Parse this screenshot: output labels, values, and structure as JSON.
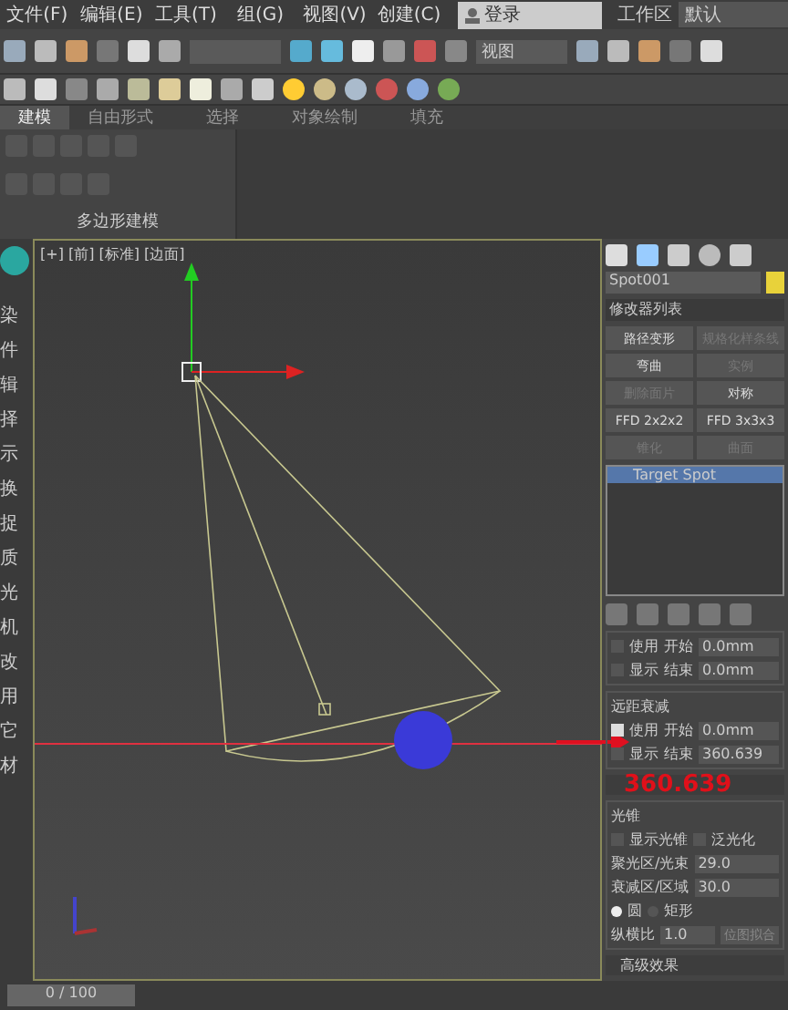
{
  "menu": [
    {
      "label": "文件(F)"
    },
    {
      "label": "编辑(E)"
    },
    {
      "label": "工具(T)"
    },
    {
      "label": "组(G)"
    },
    {
      "label": "视图(V)"
    },
    {
      "label": "创建(C)"
    }
  ],
  "login": {
    "label": "登录"
  },
  "workspace": {
    "label": "工作区",
    "value": "默认"
  },
  "toolbar": {
    "view_dropdown": "视图"
  },
  "ribbon_tabs": [
    {
      "label": "建模",
      "selected": true
    },
    {
      "label": "自由形式",
      "selected": false
    },
    {
      "label": "选择",
      "selected": false
    },
    {
      "label": "对象绘制",
      "selected": false
    },
    {
      "label": "填充",
      "selected": false
    }
  ],
  "ribbon_panel": {
    "title": "多边形建模"
  },
  "sidebar": [
    {
      "label": "染"
    },
    {
      "label": "件"
    },
    {
      "label": "辑"
    },
    {
      "label": "择"
    },
    {
      "label": "示"
    },
    {
      "label": "换"
    },
    {
      "label": "捉"
    },
    {
      "label": "质"
    },
    {
      "label": "光"
    },
    {
      "label": "机"
    },
    {
      "label": "改"
    },
    {
      "label": "用"
    },
    {
      "label": "它"
    },
    {
      "label": "材"
    }
  ],
  "viewport": {
    "label": "[+] [前] [标准] [边面]"
  },
  "timeline": {
    "text": "0 / 100"
  },
  "panel": {
    "object_name": "Spot001",
    "modifier_list": "修改器列表",
    "modifiers": [
      {
        "label": "路径变形",
        "disabled": false
      },
      {
        "label": "规格化样条线",
        "disabled": true
      },
      {
        "label": "弯曲",
        "disabled": false
      },
      {
        "label": "实例",
        "disabled": true
      },
      {
        "label": "删除面片",
        "disabled": true
      },
      {
        "label": "对称",
        "disabled": false
      },
      {
        "label": "FFD 2x2x2",
        "disabled": false
      },
      {
        "label": "FFD 3x3x3",
        "disabled": false
      },
      {
        "label": "锥化",
        "disabled": true
      },
      {
        "label": "曲面",
        "disabled": true
      }
    ],
    "stack": [
      {
        "label": "Target Spot",
        "selected": true
      }
    ]
  },
  "near_atten": {
    "rows": [
      {
        "check": "使用",
        "checked": false,
        "label": "开始",
        "value": "0.0mm"
      },
      {
        "check": "显示",
        "checked": false,
        "label": "结束",
        "value": "0.0mm"
      }
    ]
  },
  "far_atten": {
    "title": "远距衰减",
    "rows": [
      {
        "check": "使用",
        "checked": true,
        "label": "开始",
        "value": "0.0mm"
      },
      {
        "check": "显示",
        "checked": false,
        "label": "结束",
        "value": "360.639"
      }
    ]
  },
  "annotation": "360.639",
  "spot_params": {
    "group": "光锥",
    "show_cone": {
      "label": "显示光锥",
      "checked": false
    },
    "overshoot": {
      "label": "泛光化",
      "checked": false
    },
    "fields": [
      {
        "label": "聚光区/光束",
        "value": "29.0"
      },
      {
        "label": "衰减区/区域",
        "value": "30.0"
      }
    ],
    "shapes": [
      {
        "label": "圆",
        "selected": true
      },
      {
        "label": "矩形",
        "selected": false
      }
    ],
    "aspect": {
      "label": "纵横比",
      "value": "1.0",
      "button": "位图拟合"
    }
  },
  "advanced": {
    "title": "高级效果"
  }
}
